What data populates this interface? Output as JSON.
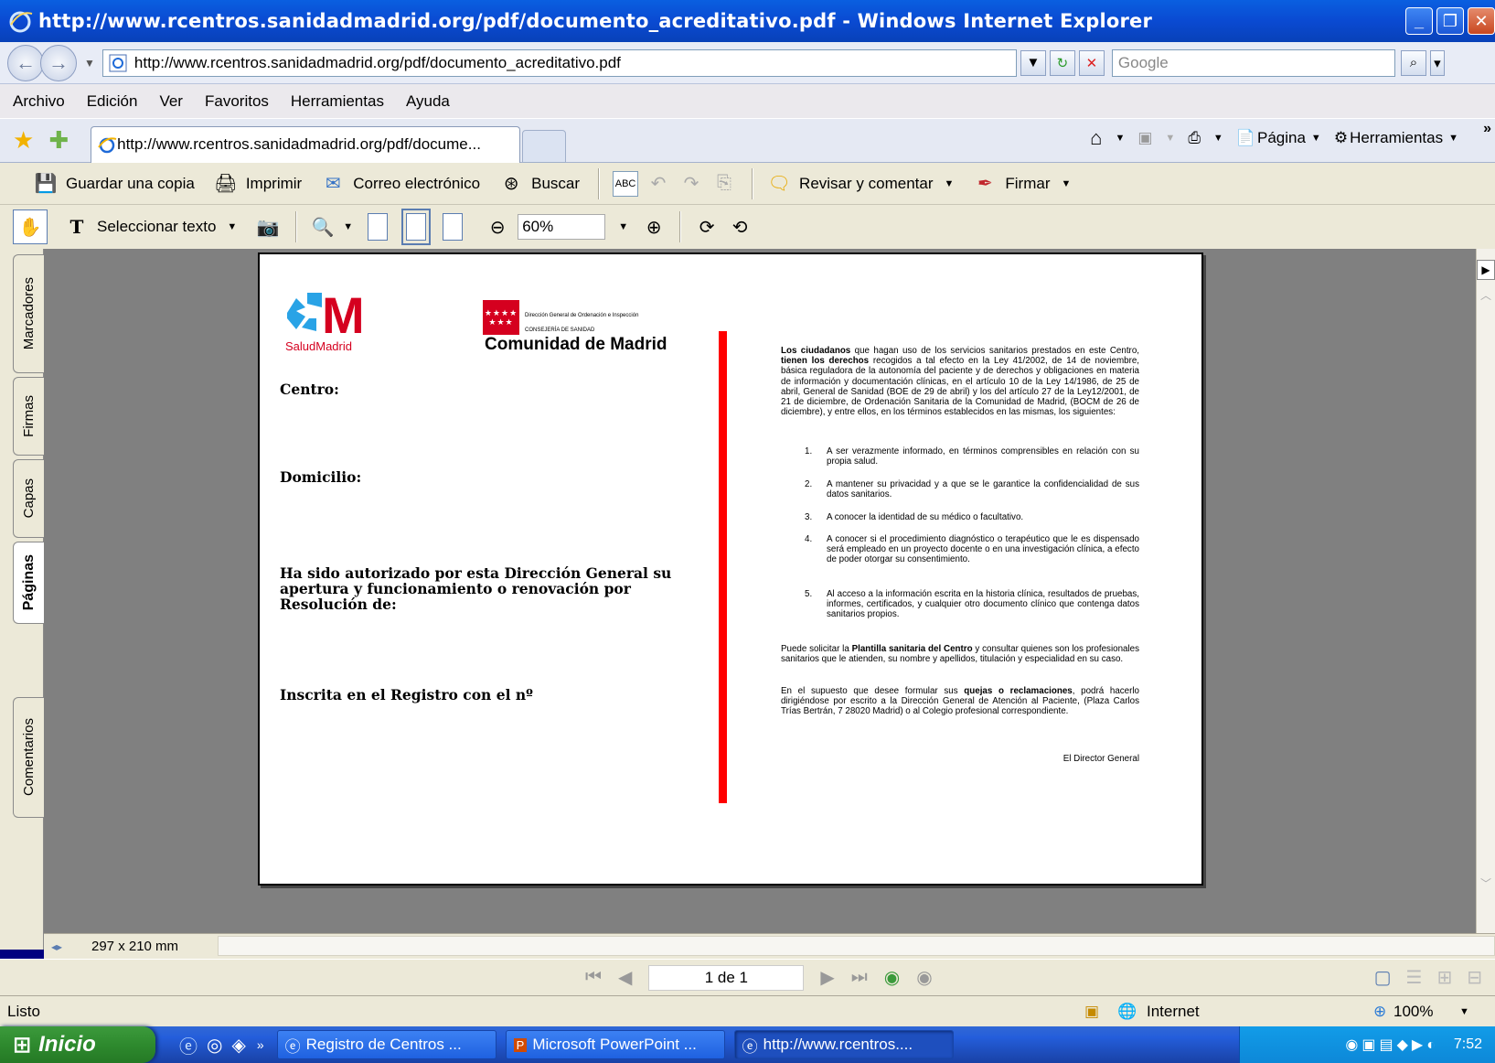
{
  "window": {
    "title": "http://www.rcentros.sanidadmadrid.org/pdf/documento_acreditativo.pdf - Windows Internet Explorer"
  },
  "address": {
    "url": "http://www.rcentros.sanidadmadrid.org/pdf/documento_acreditativo.pdf",
    "search_placeholder": "Google"
  },
  "menu": [
    "Archivo",
    "Edición",
    "Ver",
    "Favoritos",
    "Herramientas",
    "Ayuda"
  ],
  "tab": {
    "label": "http://www.rcentros.sanidadmadrid.org/pdf/docume...",
    "pagina": "Página",
    "herramientas": "Herramientas"
  },
  "acrobat": {
    "save": "Guardar una copia",
    "print": "Imprimir",
    "email": "Correo electrónico",
    "search": "Buscar",
    "review": "Revisar y comentar",
    "sign": "Firmar",
    "select_text": "Seleccionar texto",
    "zoom": "60%"
  },
  "sidetabs": [
    "Marcadores",
    "Firmas",
    "Capas",
    "Páginas",
    "Comentarios"
  ],
  "document": {
    "logo_salud": "SaludMadrid",
    "logo_dg_line1": "Dirección General de Ordenación e Inspección",
    "logo_dg_line2": "CONSEJERÍA DE SANIDAD",
    "logo_dg_line3": "Comunidad de Madrid",
    "centro": "Centro:",
    "domicilio": "Domicilio:",
    "autorizado": "Ha sido autorizado por esta Dirección General su apertura y funcionamiento o renovación por Resolución de:",
    "inscrita": "Inscrita en el Registro con el nº",
    "intro_bold1": "Los ciudadanos",
    "intro_p1": " que hagan uso de los servicios sanitarios prestados en este Centro, ",
    "intro_bold2": "tienen los derechos",
    "intro_p2": " recogidos a tal efecto en la Ley 41/2002, de 14 de noviembre, básica reguladora de la autonomía del paciente y de derechos y obligaciones en materia de información y documentación clínicas, en el artículo 10 de la Ley 14/1986, de 25 de abril, General de Sanidad (BOE de 29 de abril) y los del artículo 27 de la Ley12/2001, de 21 de diciembre, de Ordenación Sanitaria de la Comunidad de Madrid, (BOCM de 26 de diciembre), y entre ellos, en los términos establecidos en las mismas, los siguientes:",
    "rights": [
      "A ser verazmente informado, en términos comprensibles en relación con su propia salud.",
      "A mantener su privacidad y a que se le garantice la confidencialidad de sus datos sanitarios.",
      "A conocer la identidad de su médico o facultativo.",
      "A conocer si el procedimiento diagnóstico o terapéutico que le es dispensado será empleado en un proyecto docente o en una investigación clínica, a efecto de poder otorgar su consentimiento.",
      "Al acceso a la información escrita en la historia clínica, resultados de pruebas, informes, certificados, y cualquier otro documento clínico que contenga datos sanitarios propios."
    ],
    "plantilla_p1": "Puede solicitar la ",
    "plantilla_bold": "Plantilla sanitaria del Centro",
    "plantilla_p2": " y consultar quienes son los profesionales sanitarios que le atienden, su nombre y apellidos, titulación y especialidad en su caso.",
    "quejas_p1": "En el supuesto que desee formular sus ",
    "quejas_bold": "quejas o reclamaciones",
    "quejas_p2": ", podrá hacerlo dirigiéndose por escrito a la Dirección General de Atención al Paciente, (Plaza Carlos Trías Bertrán, 7 28020 Madrid) o al Colegio profesional correspondiente.",
    "director": "El Director General"
  },
  "status": {
    "page_size": "297 x 210 mm",
    "page_nav": "1 de 1",
    "ie_status": "Listo",
    "zone": "Internet",
    "zoom": "100%"
  },
  "taskbar": {
    "start": "Inicio",
    "items": [
      "Registro de Centros ...",
      "Microsoft PowerPoint ...",
      "http://www.rcentros...."
    ],
    "clock": "7:52"
  },
  "colors": {
    "title_blue": "#0a4ad2",
    "red_rule": "#ff0000",
    "salud_blue": "#1e88e5",
    "madrid_red": "#d5001f"
  }
}
